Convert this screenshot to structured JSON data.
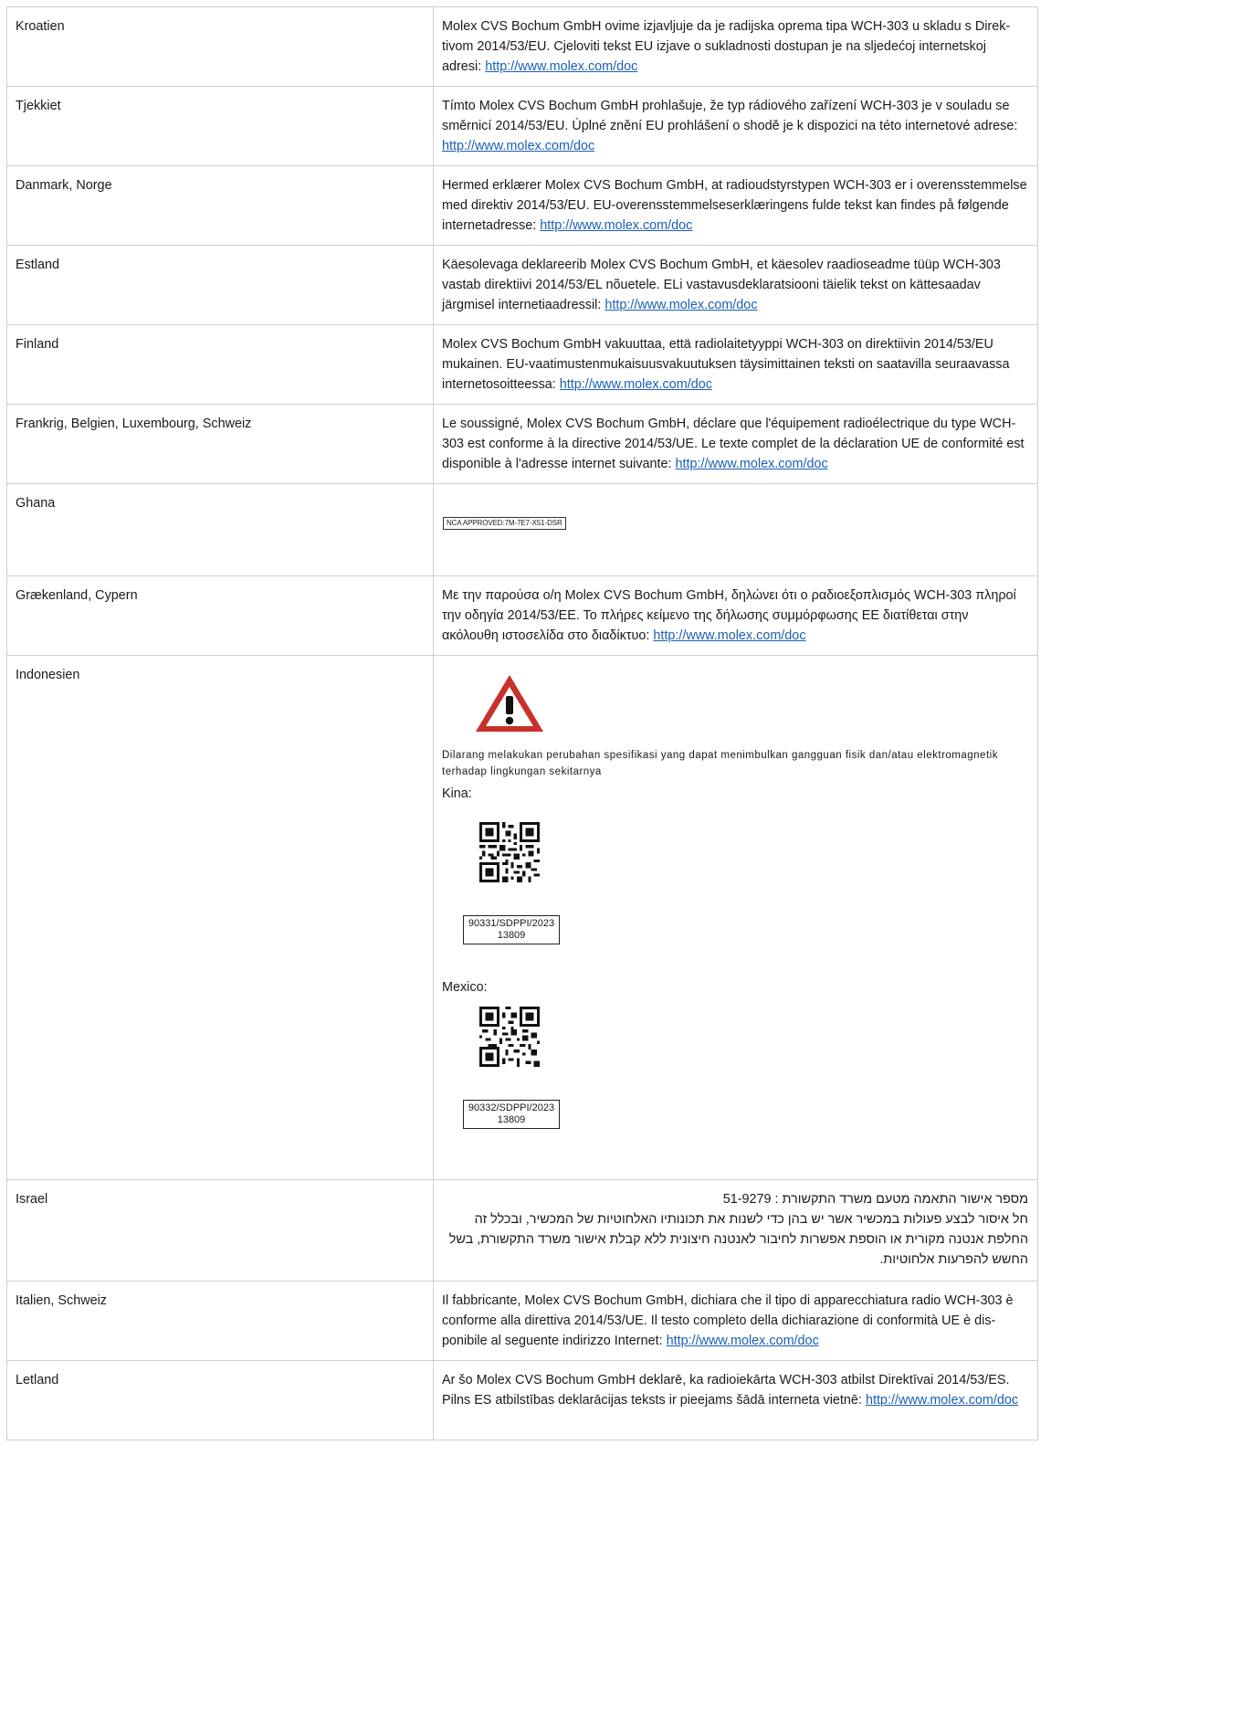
{
  "url": "http://www.molex.com/doc",
  "rows": [
    {
      "country": "Kroatien",
      "text": "Molex CVS Bochum GmbH ovime izjavljuje da je radijska oprema tipa WCH-303 u skladu s Direk­tivom 2014/53/EU. Cjeloviti tekst EU izjave o sukladnosti dostupan je na sljedećoj internetskoj adresi: "
    },
    {
      "country": "Tjekkiet",
      "text": "Tímto Molex CVS Bochum GmbH prohlašuje, že typ rádiového zařízení WCH-303 je v souladu se směrnicí 2014/53/EU. Úplné znění EU prohlášení o shodě je k dispozici na této internetové ad­rese: "
    },
    {
      "country": "Danmark, Norge",
      "text": "Hermed erklærer Molex CVS Bochum GmbH, at radioudstyrstypen WCH-303 er i overensstem­melse med direktiv 2014/53/EU. EU-overensstemmelseserklæringens fulde tekst kan findes på følgende internetadresse: "
    },
    {
      "country": "Estland",
      "text": "Käesolevaga deklareerib Molex CVS Bochum GmbH, et käesolev raadioseadme tüüp WCH-303 vastab direktiivi 2014/53/EL nõuetele. ELi vastavusdeklaratsiooni täielik tekst on kättesaadav järgmisel internetiaadressil: "
    },
    {
      "country": "Finland",
      "text": "Molex CVS Bochum GmbH vakuuttaa, että radiolaitetyyppi WCH-303 on direktiivin 2014/53/EU mukainen. EU-vaatimustenmukaisuusvakuutuksen täysimittainen teksti on saatavilla seuraavassa internetosoitteessa: "
    },
    {
      "country": "Frankrig, Belgien, Luxembourg, Schweiz",
      "text": "Le soussigné, Molex CVS Bochum GmbH, déclare que l'équipement radioélectrique du type WCH-303 est conforme à la directive 2014/53/UE. Le texte complet de la déclaration UE de conformité est disponible à l'adresse internet suivante: "
    },
    {
      "country": "Ghana",
      "nca_label": "NCA APPROVED:7M-7E7-X51-DSR"
    },
    {
      "country": "Grækenland, Cypern",
      "text": "Με την παρούσα ο/η Molex CVS Bochum GmbH, δηλώνει ότι ο ραδιοεξοπλισμός WCH-303 πληροί την οδηγία 2014/53/ΕΕ. Το πλήρες κείμενο της δήλωσης συμμόρφωσης ΕΕ διατίθεται στην ακόλουθη ιστοσελίδα στο διαδίκτυο: "
    },
    {
      "country": "Indonesien",
      "warning": "Dilarang melakukan perubahan spesifikasi yang dapat menimbulkan gangguan fisik dan/atau elektromag­netik terhadap lingkungan sekitarnya",
      "kina_label": "Kina:",
      "code1_line1": "90331/SDPPI/2023",
      "code1_line2": "13809",
      "mexico_label": "Mexico:",
      "code2_line1": "90332/SDPPI/2023",
      "code2_line2": "13809"
    },
    {
      "country": "Israel",
      "line1": "מספר אישור התאמה מטעם משרד התקשורת : 51-9279",
      "line2": "חל איסור לבצע פעולות במכשיר אשר יש בהן כדי לשנות את תכונותיו האלחוטיות של המכשיר, ובכלל זה החלפת אנטנה מקורית או הוספת אפשרות לחיבור לאנטנה חיצונית ללא קבלת אישור משרד התקשורת, בשל החשש להפרעות אלחוטיות."
    },
    {
      "country": "Italien, Schweiz",
      "text": "Il fabbricante, Molex CVS Bochum GmbH, dichiara che il tipo di apparecchiatura radio WCH-303 è conforme alla direttiva 2014/53/UE. Il testo completo della dichiarazione di conformità UE è dis­ponibile al seguente indirizzo Internet: "
    },
    {
      "country": "Letland",
      "text": "Ar šo Molex CVS Bochum GmbH deklarē, ka radioiekārta WCH-303 atbilst Direktīvai 2014/53/ES. Pilns ES atbilstības deklarācijas teksts ir pieejams šādā interneta vietnē: "
    }
  ],
  "colors": {
    "border": "#cfcfcf",
    "link": "#1a5fb4",
    "warning_red": "#c8302a"
  },
  "icons": {
    "warning": "warning-triangle-icon",
    "qr": "qr-code-icon"
  }
}
